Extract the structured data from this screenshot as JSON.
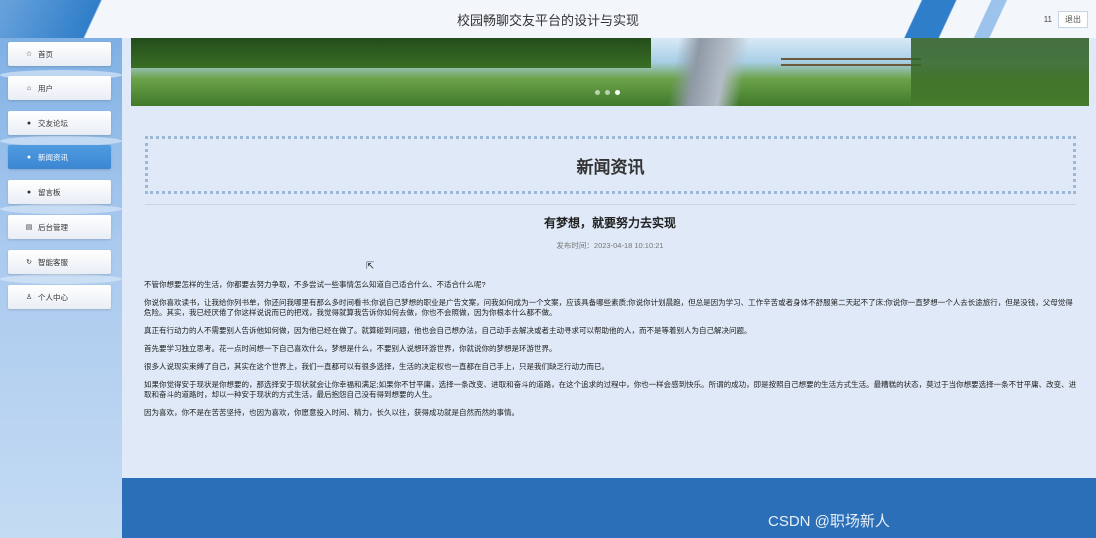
{
  "header": {
    "title": "校园畅聊交友平台的设计与实现",
    "username": "11",
    "logout_label": "退出"
  },
  "sidebar": {
    "items": [
      {
        "label": "首页",
        "icon": "star-icon",
        "glyph": "☆",
        "active": false
      },
      {
        "label": "用户",
        "icon": "home-icon",
        "glyph": "⌂",
        "active": false
      },
      {
        "label": "交友论坛",
        "icon": "info-icon",
        "glyph": "●",
        "active": false
      },
      {
        "label": "新闻资讯",
        "icon": "info-icon",
        "glyph": "●",
        "active": true
      },
      {
        "label": "留言板",
        "icon": "info-icon",
        "glyph": "●",
        "active": false
      },
      {
        "label": "后台管理",
        "icon": "admin-icon",
        "glyph": "▤",
        "active": false
      },
      {
        "label": "智能客服",
        "icon": "refresh-icon",
        "glyph": "↻",
        "active": false
      },
      {
        "label": "个人中心",
        "icon": "user-icon",
        "glyph": "♙",
        "active": false
      }
    ]
  },
  "banner": {
    "slides": 3,
    "active_slide": 3
  },
  "page": {
    "section_title": "新闻资讯",
    "article_title": "有梦想，就要努力去实现",
    "publish_time": "发布时间：2023-04-18 10:10:21",
    "paragraphs": [
      "不管你想要怎样的生活，你都要去努力争取，不多尝试一些事情怎么知道自己适合什么、不适合什么呢?",
      "你说你喜欢读书，让我给你列书单，你还问我哪里有那么多时间看书;你说自己梦想的职业是广告文案，问我如何成为一个文案，应该具备哪些素质;你说你计划晨跑，但总是因为学习、工作辛苦或者身体不舒服第二天起不了床;你说你一直梦想一个人去长途旅行，但是没钱，父母觉得危险。其实，我已经厌倦了你这样说说而已的把戏，我觉得就算我告诉你如何去做，你也不会照做，因为你根本什么都不做。",
      "真正有行动力的人不需要别人告诉他如何做，因为他已经在做了。就算碰到问题，他也会自己想办法，自己动手去解决或者主动寻求可以帮助他的人，而不是等着别人为自己解决问题。",
      "首先要学习独立思考。花一点时间想一下自己喜欢什么，梦想是什么，不要别人说想环游世界，你就说你的梦想是环游世界。",
      "很多人说现实束缚了自己，其实在这个世界上，我们一直都可以有很多选择，生活的决定权也一直都在自己手上，只是我们缺乏行动力而已。",
      "如果你觉得安于现状是你想要的，那选择安于现状就会让你幸福和满足;如果你不甘平庸，选择一条改变、进取和奋斗的道路，在这个追求的过程中，你也一样会感到快乐。所谓的成功，即是按照自己想要的生活方式生活。最糟糕的状态，莫过于当你想要选择一条不甘平庸、改变、进取和奋斗的道路时，却以一种安于现状的方式生活，最后抱怨自己没有得到想要的人生。",
      "因为喜欢，你不是在苦苦坚持，也因为喜欢，你愿意投入时间、精力，长久以往，获得成功就是自然而然的事情。"
    ]
  },
  "watermark": "CSDN @职场新人"
}
